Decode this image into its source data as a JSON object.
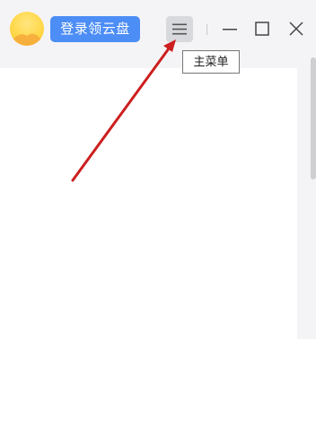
{
  "header": {
    "login_button_label": "登录领云盘",
    "main_menu_tooltip": "主菜单"
  },
  "icons": {
    "avatar": "avatar-icon",
    "menu": "hamburger-menu-icon",
    "minimize": "minimize-icon",
    "maximize": "maximize-icon",
    "close": "close-icon",
    "annotation": "red-arrow"
  },
  "colors": {
    "accent": "#4c8df6",
    "annotation_arrow": "#cc1f1f",
    "titlebar_bg": "#f4f4f6"
  }
}
